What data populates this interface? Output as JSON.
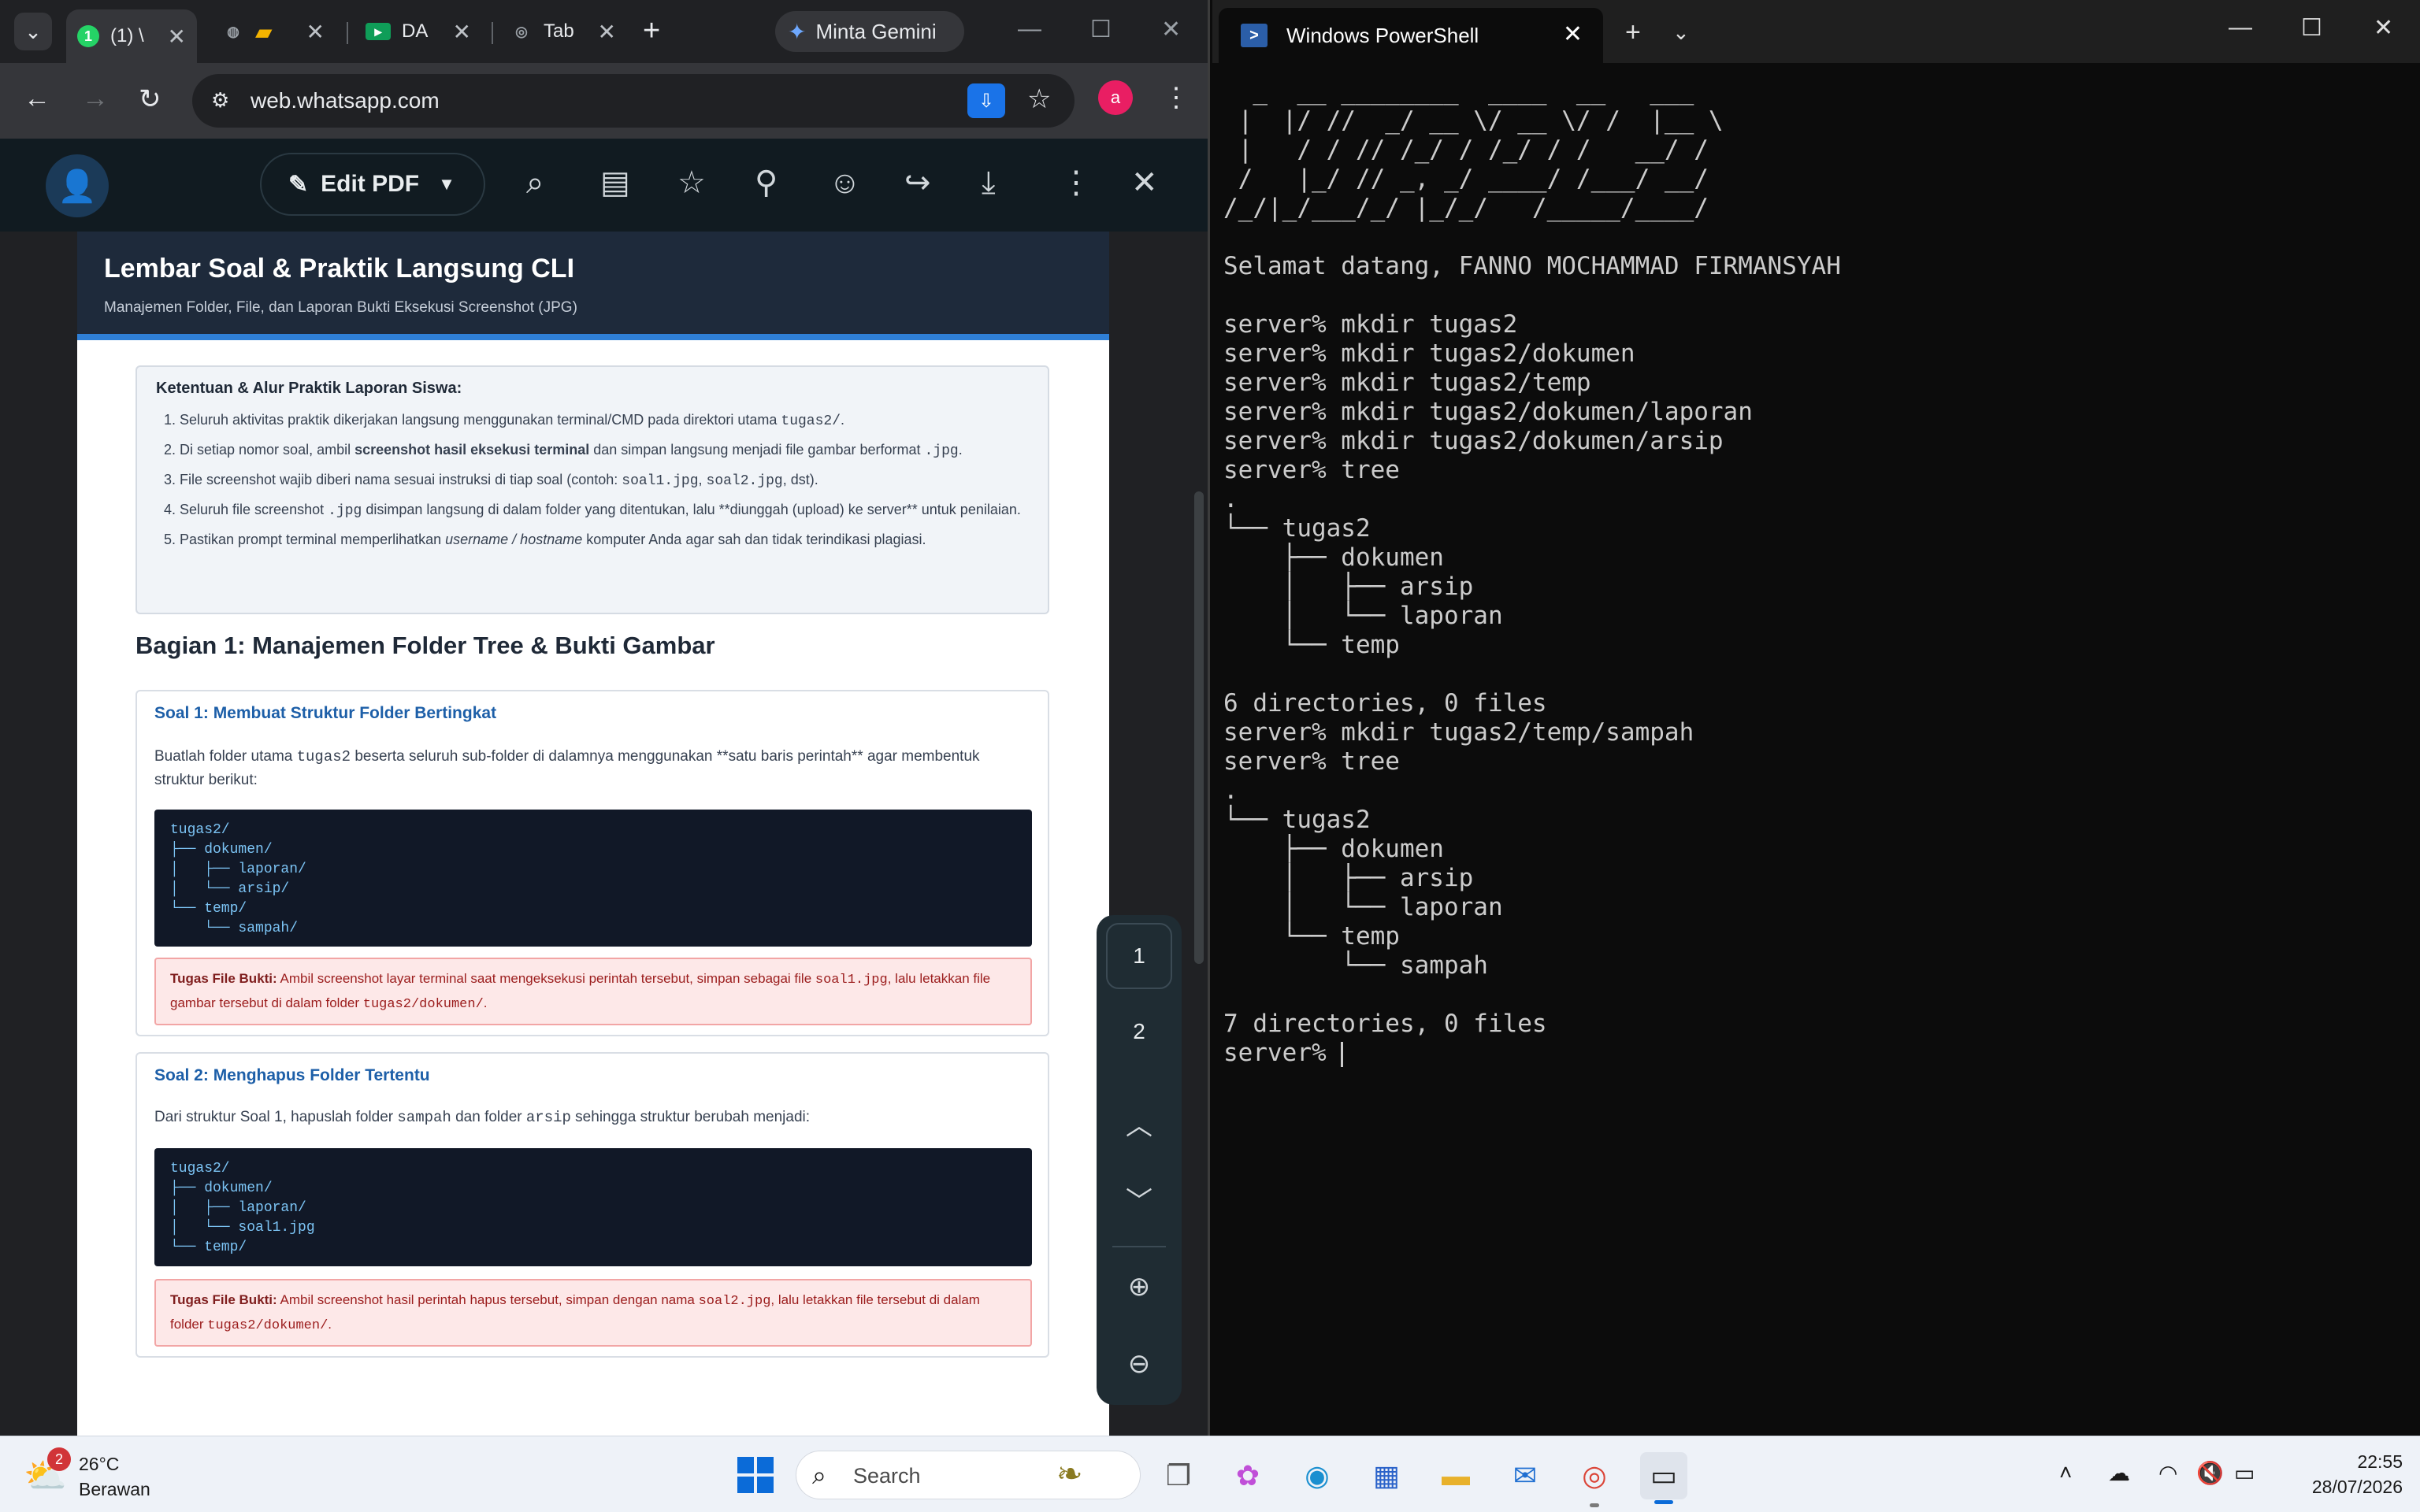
{
  "browser": {
    "tabs": [
      {
        "label": "(1) \\",
        "favicon": "whatsapp-icon",
        "active": true
      },
      {
        "label": "",
        "favicon": "globe-icon"
      },
      {
        "label": "DA",
        "favicon": "slides-icon"
      },
      {
        "label": "Tab",
        "favicon": "chrome-icon"
      }
    ],
    "gemini_label": "Minta Gemini",
    "url": "web.whatsapp.com",
    "profile_initial": "a"
  },
  "viewer": {
    "edit_pdf_label": "Edit PDF"
  },
  "pdf": {
    "title": "Lembar Soal & Praktik Langsung CLI",
    "subtitle": "Manajemen Folder, File, dan Laporan Bukti Eksekusi Screenshot (JPG)",
    "rules_title": "Ketentuan & Alur Praktik Laporan Siswa:",
    "rules": [
      "Seluruh aktivitas praktik dikerjakan langsung menggunakan terminal/CMD pada direktori utama ",
      "Di setiap nomor soal, ambil ",
      "File screenshot wajib diberi nama sesuai instruksi di tiap soal (contoh: ",
      "Seluruh file screenshot ",
      "Pastikan prompt terminal memperlihatkan "
    ],
    "rule1_code": "tugas2/",
    "rule1_end": ".",
    "rule2_bold": "screenshot hasil eksekusi terminal",
    "rule2_mid": " dan simpan langsung menjadi file gambar berformat ",
    "rule2_code": ".jpg",
    "rule2_end": ".",
    "rule3_code1": "soal1.jpg",
    "rule3_sep": ", ",
    "rule3_code2": "soal2.jpg",
    "rule3_end": ", dst).",
    "rule4_code": ".jpg",
    "rule4_end": " disimpan langsung di dalam folder yang ditentukan, lalu **diunggah (upload) ke server** untuk penilaian.",
    "rule5_italic": "username / hostname",
    "rule5_end": " komputer Anda agar sah dan tidak terindikasi plagiasi.",
    "section_title": "Bagian 1: Manajemen Folder Tree & Bukti Gambar",
    "q1": {
      "title": "Soal 1: Membuat Struktur Folder Bertingkat",
      "text_a": "Buatlah folder utama ",
      "text_code": "tugas2",
      "text_b": " beserta seluruh sub-folder di dalamnya menggunakan **satu baris perintah** agar membentuk struktur berikut:",
      "code": "tugas2/\n├── dokumen/\n│   ├── laporan/\n│   └── arsip/\n└── temp/\n    └── sampah/",
      "task_label": "Tugas File Bukti:",
      "task_a": " Ambil screenshot layar terminal saat mengeksekusi perintah tersebut, simpan sebagai file ",
      "task_code1": "soal1.jpg",
      "task_b": ", lalu letakkan file gambar tersebut di dalam folder ",
      "task_code2": "tugas2/dokumen/",
      "task_end": "."
    },
    "q2": {
      "title": "Soal 2: Menghapus Folder Tertentu",
      "text_a": "Dari struktur Soal 1, hapuslah folder ",
      "text_code1": "sampah",
      "text_b": " dan folder ",
      "text_code2": "arsip",
      "text_c": " sehingga struktur berubah menjadi:",
      "code": "tugas2/\n├── dokumen/\n│   ├── laporan/\n│   └── soal1.jpg\n└── temp/",
      "task_label": "Tugas File Bukti:",
      "task_a": " Ambil screenshot hasil perintah hapus tersebut, simpan dengan nama ",
      "task_code1": "soal2.jpg",
      "task_b": ", lalu letakkan file tersebut di dalam folder ",
      "task_code2": "tugas2/dokumen/",
      "task_end": "."
    },
    "pages": [
      "1",
      "2"
    ]
  },
  "terminal": {
    "tab_title": "Windows PowerShell",
    "output": "  _  __ ________  ____  __   ___\n |  |/ //  _/ __ \\/ __ \\/ /  |__ \\\n |   / / // /_/ / /_/ / /   __/ /\n /   |_/ // _, _/ ____/ /___/ __/\n/_/|_/___/_/ |_/_/   /_____/____/\n\nSelamat datang, FANNO MOCHAMMAD FIRMANSYAH\n\nserver% mkdir tugas2\nserver% mkdir tugas2/dokumen\nserver% mkdir tugas2/temp\nserver% mkdir tugas2/dokumen/laporan\nserver% mkdir tugas2/dokumen/arsip\nserver% tree\n.\n└── tugas2\n    ├── dokumen\n    │   ├── arsip\n    │   └── laporan\n    └── temp\n\n6 directories, 0 files\nserver% mkdir tugas2/temp/sampah\nserver% tree\n.\n└── tugas2\n    ├── dokumen\n    │   ├── arsip\n    │   └── laporan\n    └── temp\n        └── sampah\n\n7 directories, 0 files\nserver% "
  },
  "taskbar": {
    "weather_badge": "2",
    "temperature": "26°C",
    "condition": "Berawan",
    "search_placeholder": "Search",
    "time": "22:55",
    "date": "28/07/2026"
  },
  "colors": {
    "pdf_header": "#1e2a3b",
    "pdf_accent": "#2f7fd6",
    "terminal_bg": "#0c0c0c",
    "whatsapp_bar": "#111b21"
  }
}
